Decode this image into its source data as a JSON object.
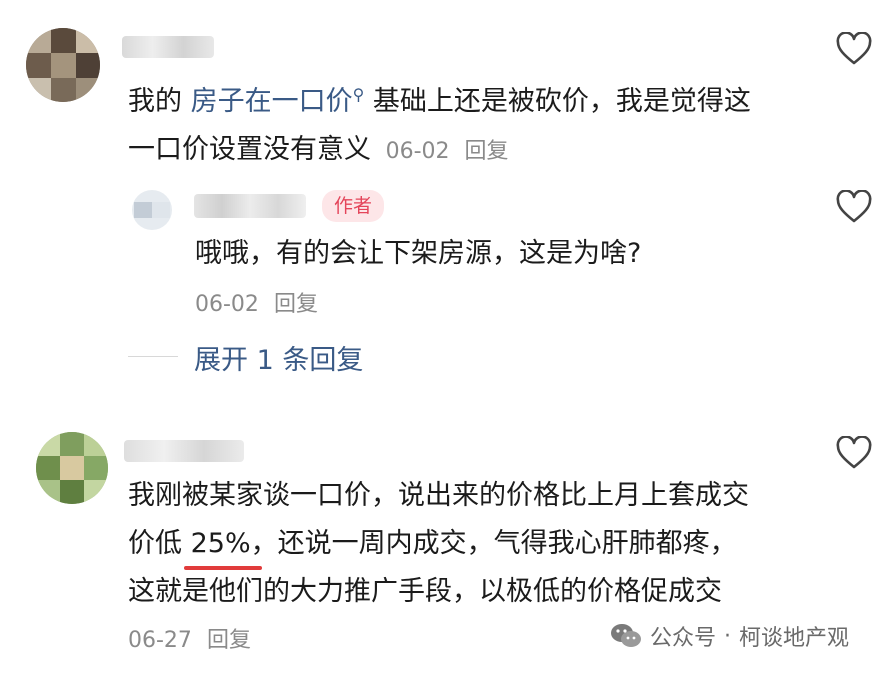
{
  "comments": [
    {
      "text_prefix": "我的 ",
      "link_text": "房子在一口价",
      "search_mark": "⚲",
      "text_line1_rest": " 基础上还是被砍价，我是觉得这",
      "text_line2": "一口价设置没有意义",
      "date": "06-02",
      "reply_label": "回复",
      "replies": [
        {
          "badge": "作者",
          "text": "哦哦，有的会让下架房源，这是为啥?",
          "date": "06-02",
          "reply_label": "回复"
        }
      ],
      "expand_label": "展开 1 条回复"
    },
    {
      "text_line1": "我刚被某家谈一口价，说出来的价格比上月上套成交",
      "text_line2_a": "价低 ",
      "text_line2_highlight": "25%",
      "text_line2_b": "，还说一周内成交，气得我心肝肺都疼，",
      "text_line3": "这就是他们的大力推广手段，以极低的价格促成交",
      "date": "06-27",
      "reply_label": "回复"
    }
  ],
  "watermark": {
    "platform": "公众号",
    "separator": "·",
    "account": "柯谈地产观"
  },
  "colors": {
    "link": "#3a5a86",
    "badge_bg": "#fde6e8",
    "badge_text": "#e4455a",
    "underline": "#e13b3b",
    "meta": "#8a8a8a"
  },
  "icons": [
    "heart-icon",
    "wechat-icon",
    "search-icon"
  ]
}
